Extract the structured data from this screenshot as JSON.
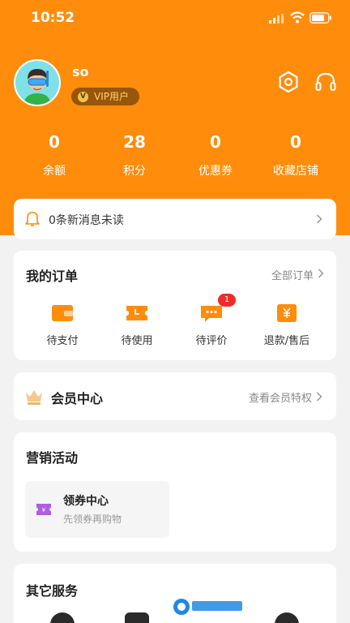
{
  "status": {
    "time": "10:52"
  },
  "profile": {
    "username": "so",
    "vip_label": "VIP用户"
  },
  "header_icons": [
    "settings-hexagon-icon",
    "customer-service-headset-icon"
  ],
  "stats": [
    {
      "value": "0",
      "label": "余额"
    },
    {
      "value": "28",
      "label": "积分"
    },
    {
      "value": "0",
      "label": "优惠券"
    },
    {
      "value": "0",
      "label": "收藏店铺"
    }
  ],
  "message": {
    "text": "0条新消息未读"
  },
  "orders": {
    "title": "我的订单",
    "all_link": "全部订单",
    "items": [
      {
        "label": "待支付",
        "icon": "wallet-icon"
      },
      {
        "label": "待使用",
        "icon": "ticket-clock-icon"
      },
      {
        "label": "待评价",
        "icon": "comment-icon",
        "badge": "1"
      },
      {
        "label": "退款/售后",
        "icon": "refund-yen-icon"
      }
    ]
  },
  "member": {
    "title": "会员中心",
    "link": "查看会员特权"
  },
  "marketing": {
    "title": "营销活动",
    "coupon_title": "领券中心",
    "coupon_sub": "先领券再购物"
  },
  "services": {
    "title": "其它服务"
  },
  "colors": {
    "brand": "#ff8c0b",
    "badge": "#f02b2b",
    "coupon": "#b05fe0",
    "vip_text": "#ffd36b"
  }
}
